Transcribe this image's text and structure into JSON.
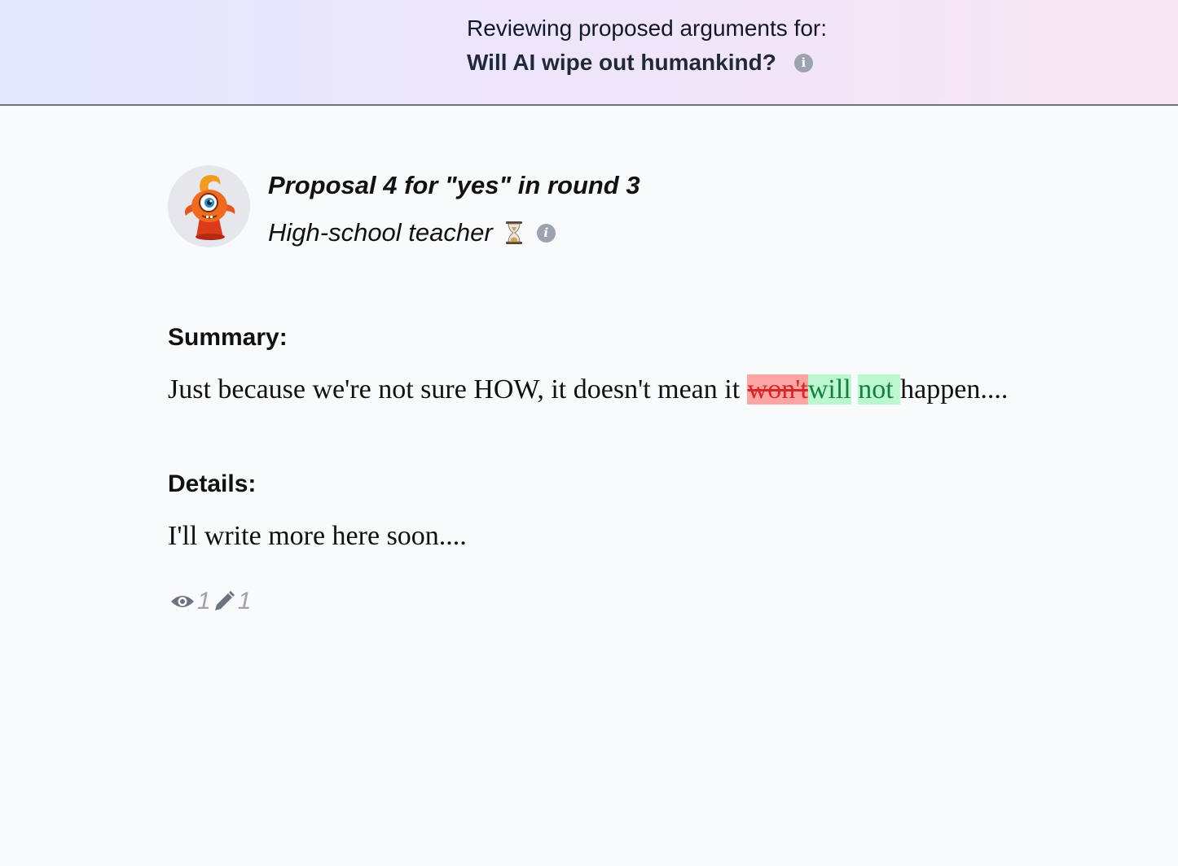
{
  "header": {
    "line1": "Reviewing proposed arguments for:",
    "question": "Will AI wipe out humankind?",
    "info_icon": "info-icon"
  },
  "proposal": {
    "title": "Proposal 4 for \"yes\" in round 3",
    "persona": "High-school teacher",
    "status_icon": "hourglass-icon",
    "avatar_icon": "orange-cyclops-mascot"
  },
  "summary": {
    "label": "Summary:",
    "text_before": "Just because we're not sure HOW, it doesn't mean it ",
    "deleted": "won't",
    "inserted1": "will",
    "between": " ",
    "inserted2": "not ",
    "text_after": "happen...."
  },
  "details": {
    "label": "Details:",
    "text": "I'll write more here soon...."
  },
  "stats": {
    "views": "1",
    "edits": "1"
  },
  "colors": {
    "deleted_bg": "#fca5a5",
    "deleted_text": "#dc2626",
    "inserted_bg": "#bbf7d0",
    "inserted_text": "#15803d",
    "header_border": "#6b7280"
  }
}
